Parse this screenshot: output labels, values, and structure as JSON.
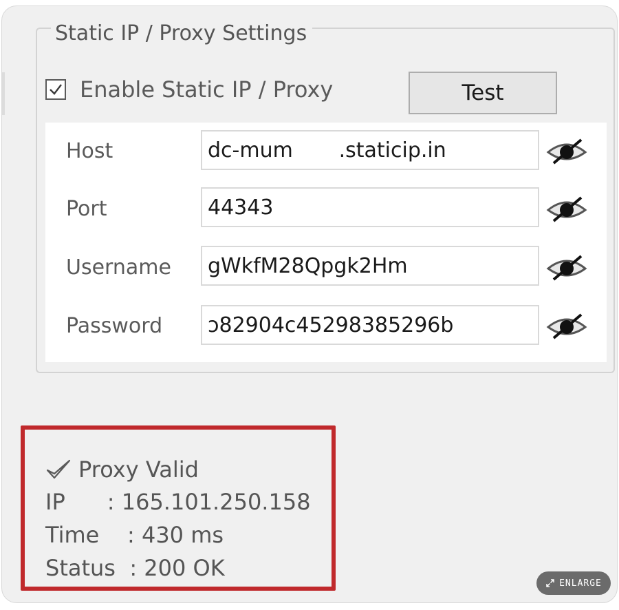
{
  "group": {
    "title": "Static IP / Proxy Settings"
  },
  "enable": {
    "label": "Enable Static IP / Proxy",
    "checked": true
  },
  "test_button": {
    "label": "Test"
  },
  "fields": [
    {
      "label": "Host",
      "value": "dc-mum       .staticip.in",
      "icon": "eye-hidden-icon"
    },
    {
      "label": "Port",
      "value": "44343",
      "icon": "eye-hidden-icon"
    },
    {
      "label": "Username",
      "value": "gWkfM28Qpgk2Hm",
      "icon": "eye-hidden-icon"
    },
    {
      "label": "Password",
      "value": "ɔ82904c45298385296b",
      "icon": "eye-hidden-icon"
    }
  ],
  "result": {
    "valid_text": "Proxy Valid",
    "ip_line": "IP      : 165.101.250.158",
    "time_line": "Time    : 430 ms",
    "status_line": "Status  : 200 OK",
    "highlight_color": "#c0292c"
  },
  "enlarge": {
    "label": "ENLARGE"
  }
}
